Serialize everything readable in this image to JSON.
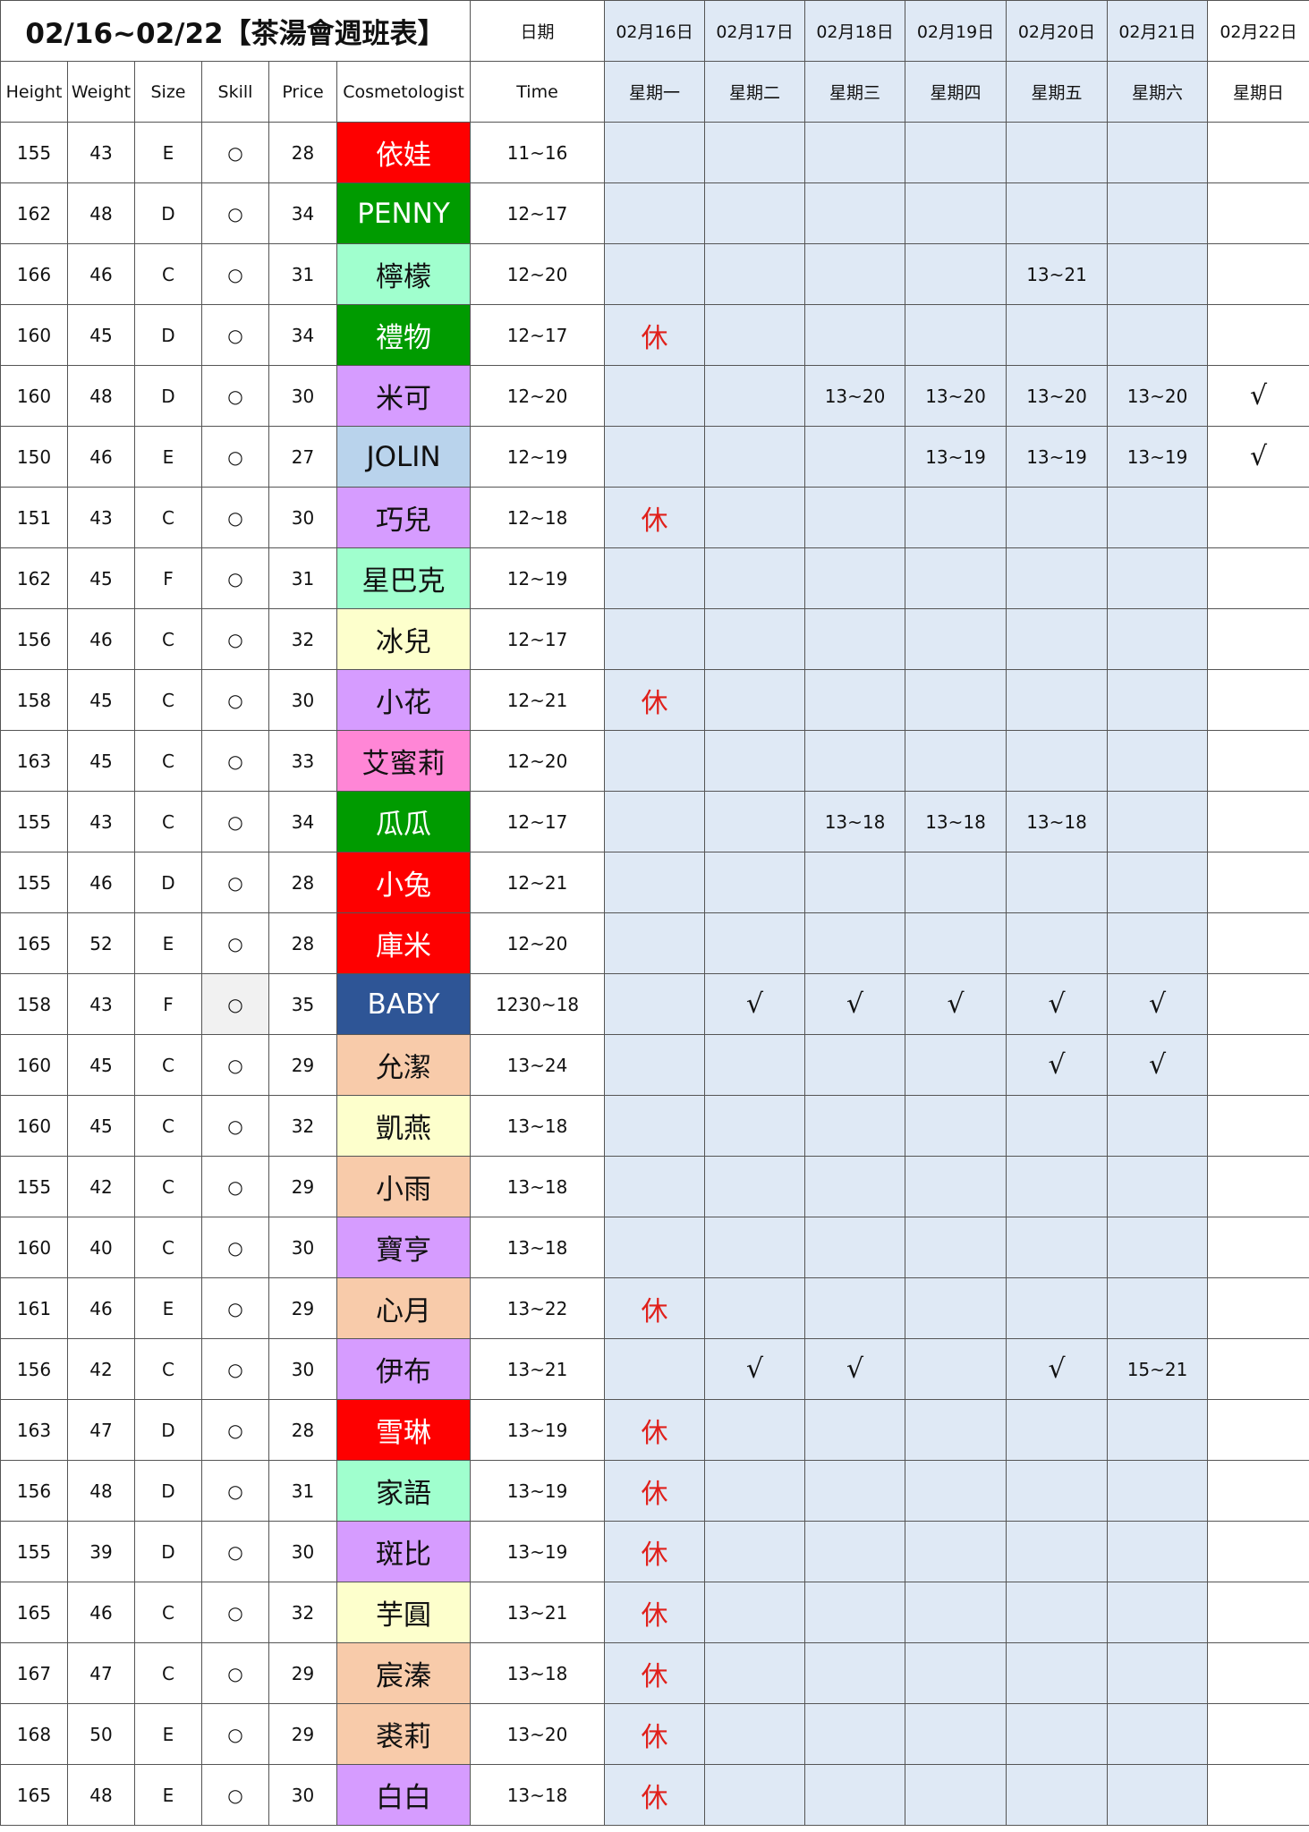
{
  "title": "02/16~02/22【茶湯會週班表】",
  "date_label": "日期",
  "dates": [
    "02月16日",
    "02月17日",
    "02月18日",
    "02月19日",
    "02月20日",
    "02月21日",
    "02月22日"
  ],
  "columns": [
    "Height",
    "Weight",
    "Size",
    "Skill",
    "Price",
    "Cosmetologist",
    "Time"
  ],
  "weekdays": [
    "星期一",
    "星期二",
    "星期三",
    "星期四",
    "星期五",
    "星期六",
    "星期日"
  ],
  "colors": {
    "red": "#fe0000",
    "green": "#009b00",
    "mint": "#a0ffce",
    "lavender": "#d69cff",
    "lightblue": "#b9d3ec",
    "cream": "#fdffcc",
    "pink": "#ff86d6",
    "navy": "#2e5596",
    "peach": "#f8cbaa",
    "rest": "#e0201b",
    "date_blue": "#dfe9f5"
  },
  "rows": [
    {
      "height": "155",
      "weight": "43",
      "size": "E",
      "skill": "○",
      "price": "28",
      "name": "依娃",
      "bg": "#fe0000",
      "fg": "#ffffff",
      "time": "11~16",
      "days": [
        "",
        "",
        "",
        "",
        "",
        "",
        ""
      ]
    },
    {
      "height": "162",
      "weight": "48",
      "size": "D",
      "skill": "○",
      "price": "34",
      "name": "PENNY",
      "bg": "#009b00",
      "fg": "#ffffff",
      "time": "12~17",
      "days": [
        "",
        "",
        "",
        "",
        "",
        "",
        ""
      ]
    },
    {
      "height": "166",
      "weight": "46",
      "size": "C",
      "skill": "○",
      "price": "31",
      "name": "檸檬",
      "bg": "#a0ffce",
      "fg": "#111111",
      "time": "12~20",
      "days": [
        "",
        "",
        "",
        "",
        "13~21",
        "",
        ""
      ]
    },
    {
      "height": "160",
      "weight": "45",
      "size": "D",
      "skill": "○",
      "price": "34",
      "name": "禮物",
      "bg": "#009b00",
      "fg": "#ffffff",
      "time": "12~17",
      "days": [
        "休",
        "",
        "",
        "",
        "",
        "",
        ""
      ]
    },
    {
      "height": "160",
      "weight": "48",
      "size": "D",
      "skill": "○",
      "price": "30",
      "name": "米可",
      "bg": "#d69cff",
      "fg": "#111111",
      "time": "12~20",
      "days": [
        "",
        "",
        "13~20",
        "13~20",
        "13~20",
        "13~20",
        "√"
      ]
    },
    {
      "height": "150",
      "weight": "46",
      "size": "E",
      "skill": "○",
      "price": "27",
      "name": "JOLIN",
      "bg": "#b9d3ec",
      "fg": "#111111",
      "time": "12~19",
      "days": [
        "",
        "",
        "",
        "13~19",
        "13~19",
        "13~19",
        "√"
      ]
    },
    {
      "height": "151",
      "weight": "43",
      "size": "C",
      "skill": "○",
      "price": "30",
      "name": "巧兒",
      "bg": "#d69cff",
      "fg": "#111111",
      "time": "12~18",
      "days": [
        "休",
        "",
        "",
        "",
        "",
        "",
        ""
      ]
    },
    {
      "height": "162",
      "weight": "45",
      "size": "F",
      "skill": "○",
      "price": "31",
      "name": "星巴克",
      "bg": "#a0ffce",
      "fg": "#111111",
      "time": "12~19",
      "days": [
        "",
        "",
        "",
        "",
        "",
        "",
        ""
      ]
    },
    {
      "height": "156",
      "weight": "46",
      "size": "C",
      "skill": "○",
      "price": "32",
      "name": "冰兒",
      "bg": "#fdffcc",
      "fg": "#111111",
      "time": "12~17",
      "days": [
        "",
        "",
        "",
        "",
        "",
        "",
        ""
      ]
    },
    {
      "height": "158",
      "weight": "45",
      "size": "C",
      "skill": "○",
      "price": "30",
      "name": "小花",
      "bg": "#d69cff",
      "fg": "#111111",
      "time": "12~21",
      "days": [
        "休",
        "",
        "",
        "",
        "",
        "",
        ""
      ]
    },
    {
      "height": "163",
      "weight": "45",
      "size": "C",
      "skill": "○",
      "price": "33",
      "name": "艾蜜莉",
      "bg": "#ff86d6",
      "fg": "#111111",
      "time": "12~20",
      "days": [
        "",
        "",
        "",
        "",
        "",
        "",
        ""
      ]
    },
    {
      "height": "155",
      "weight": "43",
      "size": "C",
      "skill": "○",
      "price": "34",
      "name": "瓜瓜",
      "bg": "#009b00",
      "fg": "#ffffff",
      "time": "12~17",
      "days": [
        "",
        "",
        "13~18",
        "13~18",
        "13~18",
        "",
        ""
      ]
    },
    {
      "height": "155",
      "weight": "46",
      "size": "D",
      "skill": "○",
      "price": "28",
      "name": "小兔",
      "bg": "#fe0000",
      "fg": "#ffffff",
      "time": "12~21",
      "days": [
        "",
        "",
        "",
        "",
        "",
        "",
        ""
      ]
    },
    {
      "height": "165",
      "weight": "52",
      "size": "E",
      "skill": "○",
      "price": "28",
      "name": "庫米",
      "bg": "#fe0000",
      "fg": "#ffffff",
      "time": "12~20",
      "days": [
        "",
        "",
        "",
        "",
        "",
        "",
        ""
      ]
    },
    {
      "height": "158",
      "weight": "43",
      "size": "F",
      "skill": "○",
      "price": "35",
      "name": "BABY",
      "bg": "#2e5596",
      "fg": "#ffffff",
      "time": "1230~18",
      "skill_gray": true,
      "days": [
        "",
        "√",
        "√",
        "√",
        "√",
        "√",
        ""
      ]
    },
    {
      "height": "160",
      "weight": "45",
      "size": "C",
      "skill": "○",
      "price": "29",
      "name": "允潔",
      "bg": "#f8cbaa",
      "fg": "#111111",
      "time": "13~24",
      "days": [
        "",
        "",
        "",
        "",
        "√",
        "√",
        ""
      ]
    },
    {
      "height": "160",
      "weight": "45",
      "size": "C",
      "skill": "○",
      "price": "32",
      "name": "凱燕",
      "bg": "#fdffcc",
      "fg": "#111111",
      "time": "13~18",
      "days": [
        "",
        "",
        "",
        "",
        "",
        "",
        ""
      ]
    },
    {
      "height": "155",
      "weight": "42",
      "size": "C",
      "skill": "○",
      "price": "29",
      "name": "小雨",
      "bg": "#f8cbaa",
      "fg": "#111111",
      "time": "13~18",
      "days": [
        "",
        "",
        "",
        "",
        "",
        "",
        ""
      ]
    },
    {
      "height": "160",
      "weight": "40",
      "size": "C",
      "skill": "○",
      "price": "30",
      "name": "寶亨",
      "bg": "#d69cff",
      "fg": "#111111",
      "time": "13~18",
      "days": [
        "",
        "",
        "",
        "",
        "",
        "",
        ""
      ]
    },
    {
      "height": "161",
      "weight": "46",
      "size": "E",
      "skill": "○",
      "price": "29",
      "name": "心月",
      "bg": "#f8cbaa",
      "fg": "#111111",
      "time": "13~22",
      "days": [
        "休",
        "",
        "",
        "",
        "",
        "",
        ""
      ]
    },
    {
      "height": "156",
      "weight": "42",
      "size": "C",
      "skill": "○",
      "price": "30",
      "name": "伊布",
      "bg": "#d69cff",
      "fg": "#111111",
      "time": "13~21",
      "days": [
        "",
        "√",
        "√",
        "",
        "√",
        "15~21",
        ""
      ]
    },
    {
      "height": "163",
      "weight": "47",
      "size": "D",
      "skill": "○",
      "price": "28",
      "name": "雪琳",
      "bg": "#fe0000",
      "fg": "#ffffff",
      "time": "13~19",
      "days": [
        "休",
        "",
        "",
        "",
        "",
        "",
        ""
      ]
    },
    {
      "height": "156",
      "weight": "48",
      "size": "D",
      "skill": "○",
      "price": "31",
      "name": "家語",
      "bg": "#a0ffce",
      "fg": "#111111",
      "time": "13~19",
      "days": [
        "休",
        "",
        "",
        "",
        "",
        "",
        ""
      ]
    },
    {
      "height": "155",
      "weight": "39",
      "size": "D",
      "skill": "○",
      "price": "30",
      "name": "斑比",
      "bg": "#d69cff",
      "fg": "#111111",
      "time": "13~19",
      "days": [
        "休",
        "",
        "",
        "",
        "",
        "",
        ""
      ]
    },
    {
      "height": "165",
      "weight": "46",
      "size": "C",
      "skill": "○",
      "price": "32",
      "name": "芋圓",
      "bg": "#fdffcc",
      "fg": "#111111",
      "time": "13~21",
      "days": [
        "休",
        "",
        "",
        "",
        "",
        "",
        ""
      ]
    },
    {
      "height": "167",
      "weight": "47",
      "size": "C",
      "skill": "○",
      "price": "29",
      "name": "宸溱",
      "bg": "#f8cbaa",
      "fg": "#111111",
      "time": "13~18",
      "days": [
        "休",
        "",
        "",
        "",
        "",
        "",
        ""
      ]
    },
    {
      "height": "168",
      "weight": "50",
      "size": "E",
      "skill": "○",
      "price": "29",
      "name": "裘莉",
      "bg": "#f8cbaa",
      "fg": "#111111",
      "time": "13~20",
      "days": [
        "休",
        "",
        "",
        "",
        "",
        "",
        ""
      ]
    },
    {
      "height": "165",
      "weight": "48",
      "size": "E",
      "skill": "○",
      "price": "30",
      "name": "白白",
      "bg": "#d69cff",
      "fg": "#111111",
      "time": "13~18",
      "days": [
        "休",
        "",
        "",
        "",
        "",
        "",
        ""
      ]
    }
  ]
}
